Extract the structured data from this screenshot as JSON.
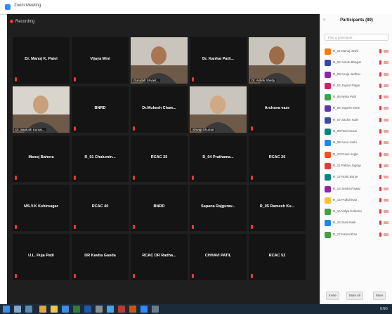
{
  "window": {
    "title": "Zoom Meeting"
  },
  "meeting": {
    "recording_label": "Recording"
  },
  "colors": {
    "accent": "#2d8cff",
    "active_speaker": "#8ee000",
    "muted": "#e53935",
    "tile_bg": "#141414",
    "stage_bg": "#1f1f1f"
  },
  "tiles": [
    {
      "name": "Dr. Manoj K. Patel",
      "video": false
    },
    {
      "name": "Vijaya Mini",
      "video": false
    },
    {
      "name": "Gurudatt Srivast...",
      "video": true,
      "highlight": false
    },
    {
      "name": "Dr. Kanhai Patil...",
      "video": false
    },
    {
      "name": "Dr. Ashok Shetty",
      "video": true,
      "highlight": false
    },
    {
      "name": "Dr. Santosh Kumar...",
      "video": true,
      "highlight": false
    },
    {
      "name": "BNRD",
      "video": false
    },
    {
      "name": "Dr.Mukesh Chaw...",
      "video": false
    },
    {
      "name": "Shivaji Dhumal",
      "video": true,
      "highlight": true
    },
    {
      "name": "Archana vaze",
      "video": false
    },
    {
      "name": "Manoj Bahera",
      "video": false
    },
    {
      "name": "R_01 Chalumin...",
      "video": false
    },
    {
      "name": "RCAC 25",
      "video": false
    },
    {
      "name": "D_04 Prathama...",
      "video": false
    },
    {
      "name": "RCAC 26",
      "video": false
    },
    {
      "name": "MS.V.K Kshirsagar",
      "video": false
    },
    {
      "name": "RCAC 40",
      "video": false
    },
    {
      "name": "BNRD",
      "video": false
    },
    {
      "name": "Sapana Rajgurav...",
      "video": false
    },
    {
      "name": "R_05 Ramesh Ku...",
      "video": false
    },
    {
      "name": "U.L. Puja Patil",
      "video": false
    },
    {
      "name": "DR Kavita Gaoda",
      "video": false
    },
    {
      "name": "RCAC DR Radha...",
      "video": false
    },
    {
      "name": "CHHAVI PATIL",
      "video": false
    },
    {
      "name": "RCAC 52",
      "video": false
    }
  ],
  "panel": {
    "title": "Participants (89)",
    "close": "×",
    "search_placeholder": "Find a participant",
    "participants": [
      {
        "name": "R_01 Manoj Joshi",
        "color": "#f57c00"
      },
      {
        "name": "R_02 Ashok Bhagat",
        "color": "#3949ab"
      },
      {
        "name": "R_03 Anuja Jadhav",
        "color": "#8e24aa"
      },
      {
        "name": "R_04 Jayant Pagar",
        "color": "#d81b60"
      },
      {
        "name": "R_05 Neha Patil",
        "color": "#43a047"
      },
      {
        "name": "R_06 Yogesh More",
        "color": "#5e35b1"
      },
      {
        "name": "R_07 Sachin Kale",
        "color": "#3949ab"
      },
      {
        "name": "R_08 Ravi Desai",
        "color": "#00897b"
      },
      {
        "name": "R_09 Amol Joshi",
        "color": "#1e88e5"
      },
      {
        "name": "R_10 Pravin Ingle",
        "color": "#f4511e"
      },
      {
        "name": "R_11 Pallavi Jagtap",
        "color": "#e53935"
      },
      {
        "name": "R_12 Rohit Borse",
        "color": "#00897b"
      },
      {
        "name": "R_13 Sneha Pawar",
        "color": "#8e24aa"
      },
      {
        "name": "R_14 Prafull Nair",
        "color": "#fbc02d"
      },
      {
        "name": "R_15 Vidya Kulkarni",
        "color": "#43a047"
      },
      {
        "name": "R_16 Sunil Naik",
        "color": "#1e88e5"
      },
      {
        "name": "R_17 Kamal Rao",
        "color": "#43a047"
      }
    ],
    "footer": {
      "invite": "Invite",
      "mute_all": "Mute All",
      "more": "More"
    }
  },
  "taskbar": {
    "tray": "ENG"
  }
}
